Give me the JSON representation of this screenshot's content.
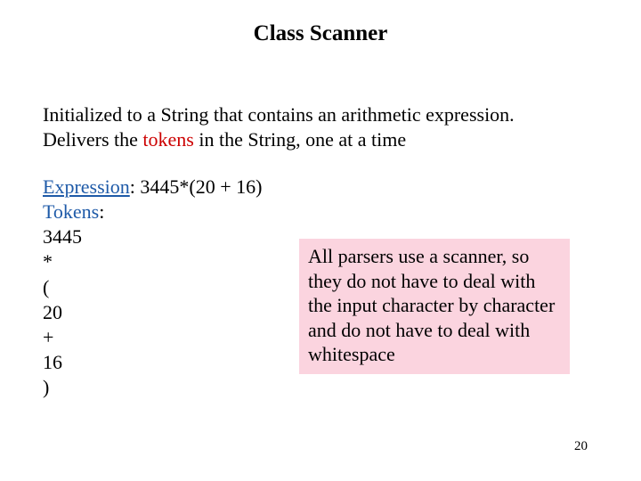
{
  "title": "Class Scanner",
  "intro": {
    "line1_before": "Initialized to a String that contains an arithmetic expression.",
    "line2_before": "Delivers the ",
    "line2_red": "tokens",
    "line2_after": " in the String, one at a time"
  },
  "expression": {
    "label": "Expression",
    "value": "3445*(20 + 16)"
  },
  "tokens_label": "Tokens",
  "tokens": [
    "3445",
    "*",
    "(",
    "20",
    "+",
    "16",
    ")"
  ],
  "callout": "All parsers use a scanner, so they do not have to deal with the input character by character and do not have to deal with whitespace",
  "page_number": "20"
}
